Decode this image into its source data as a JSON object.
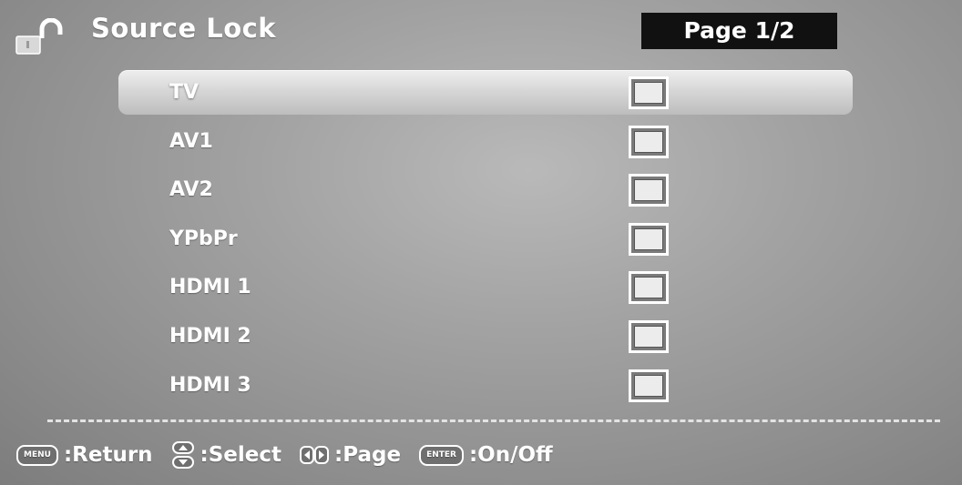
{
  "header": {
    "title": "Source Lock",
    "page_indicator": "Page 1/2",
    "icon": "unlocked-padlock-icon"
  },
  "sources": [
    {
      "label": "TV",
      "locked": false,
      "selected": true
    },
    {
      "label": "AV1",
      "locked": false,
      "selected": false
    },
    {
      "label": "AV2",
      "locked": false,
      "selected": false
    },
    {
      "label": "YPbPr",
      "locked": false,
      "selected": false
    },
    {
      "label": "HDMI 1",
      "locked": false,
      "selected": false
    },
    {
      "label": "HDMI 2",
      "locked": false,
      "selected": false
    },
    {
      "label": "HDMI 3",
      "locked": false,
      "selected": false
    }
  ],
  "footer": {
    "menu_key": "MENU",
    "return_label": ":Return",
    "select_label": ":Select",
    "page_label": ":Page",
    "enter_key": "ENTER",
    "onoff_label": ":On/Off"
  },
  "colors": {
    "background": "#a3a3a3",
    "highlight": "#dcdcdc",
    "page_badge": "#111111",
    "text": "#ffffff"
  }
}
